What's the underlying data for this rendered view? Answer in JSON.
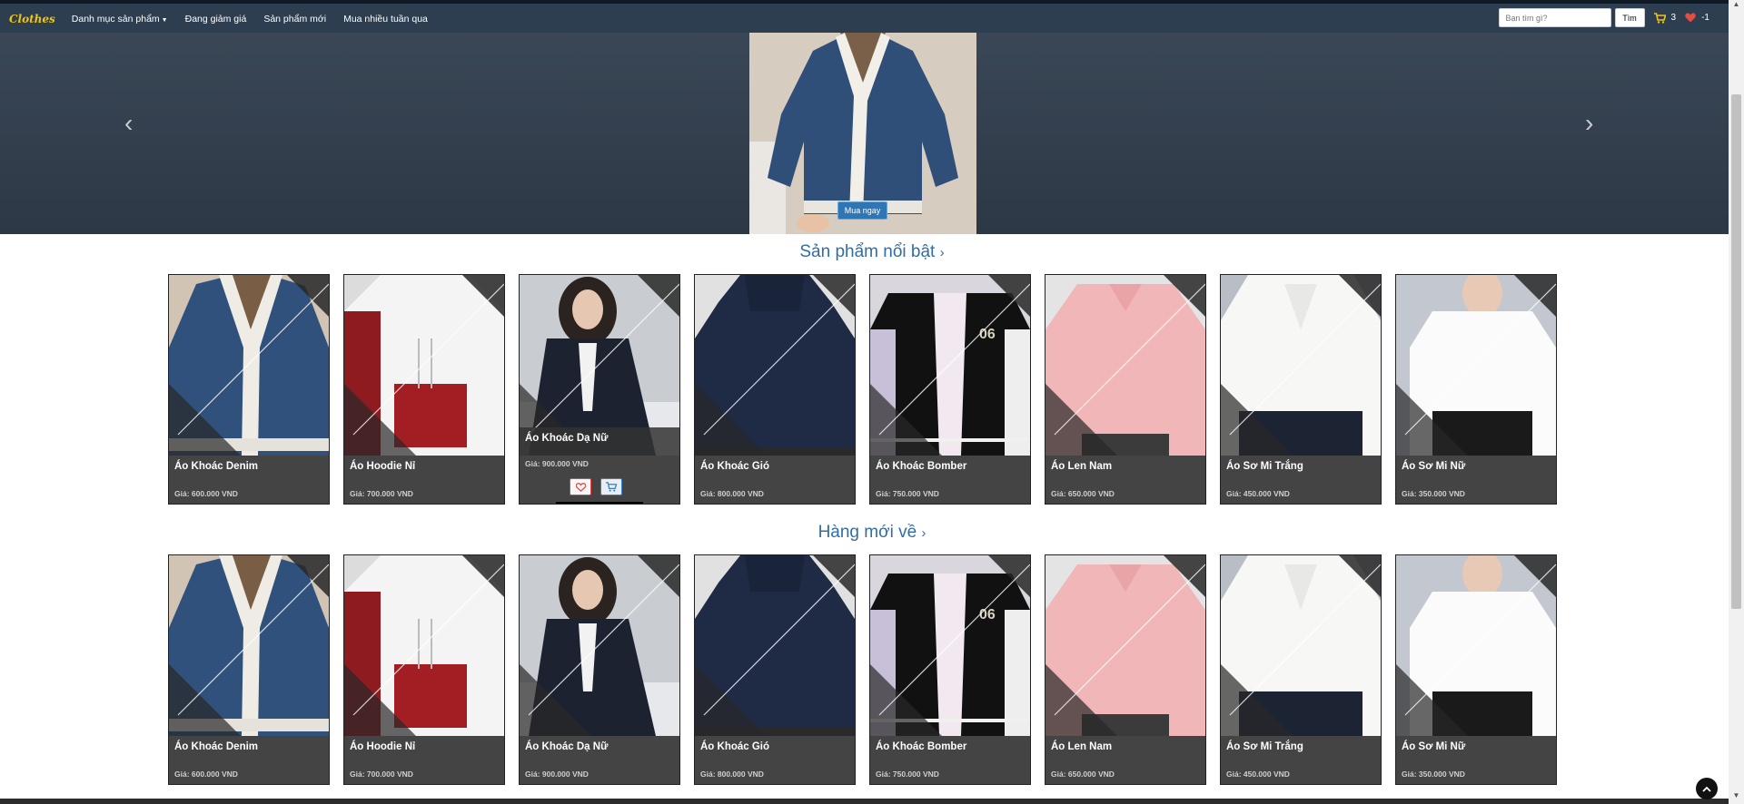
{
  "navbar": {
    "brand": "Clothes",
    "links": [
      "Danh mục sản phẩm",
      "Đang giảm giá",
      "Sản phẩm mới",
      "Mua nhiều tuần qua"
    ],
    "search_placeholder": "Bạn tìm gì?",
    "search_button": "Tìm",
    "cart_count": "3",
    "wishlist_count": "-1",
    "cart_color": "#f1c40f",
    "heart_color": "#e74c3c"
  },
  "hero": {
    "buy_now": "Mua ngay",
    "prev_icon": "chevron-left-icon",
    "next_icon": "chevron-right-icon"
  },
  "sections": [
    {
      "title": "Sản phẩm nổi bật",
      "products": [
        {
          "name": "Áo Khoác Denim",
          "price": "Giá: 600.000 VND"
        },
        {
          "name": "Áo Hoodie Nỉ",
          "price": "Giá: 700.000 VND"
        },
        {
          "name": "Áo Khoác Dạ Nữ",
          "price": "Giá: 900.000 VND"
        },
        {
          "name": "Áo Khoác Gió",
          "price": "Giá: 800.000 VND"
        },
        {
          "name": "Áo Khoác Bomber",
          "price": "Giá: 750.000 VND"
        },
        {
          "name": "Áo Len Nam",
          "price": "Giá: 650.000 VND"
        },
        {
          "name": "Áo Sơ Mi Trắng",
          "price": "Giá: 450.000 VND"
        },
        {
          "name": "Áo Sơ Mi Nữ",
          "price": "Giá: 350.000 VND"
        }
      ]
    },
    {
      "title": "Hàng mới về",
      "products": [
        {
          "name": "Áo Khoác Denim",
          "price": "Giá: 600.000 VND"
        },
        {
          "name": "Áo Hoodie Nỉ",
          "price": "Giá: 700.000 VND"
        },
        {
          "name": "Áo Khoác Dạ Nữ",
          "price": "Giá: 900.000 VND"
        },
        {
          "name": "Áo Khoác Gió",
          "price": "Giá: 800.000 VND"
        },
        {
          "name": "Áo Khoác Bomber",
          "price": "Giá: 750.000 VND"
        },
        {
          "name": "Áo Len Nam",
          "price": "Giá: 650.000 VND"
        },
        {
          "name": "Áo Sơ Mi Trắng",
          "price": "Giá: 450.000 VND"
        },
        {
          "name": "Áo Sơ Mi Nữ",
          "price": "Giá: 350.000 VND"
        }
      ]
    }
  ],
  "bomber_print": "06"
}
